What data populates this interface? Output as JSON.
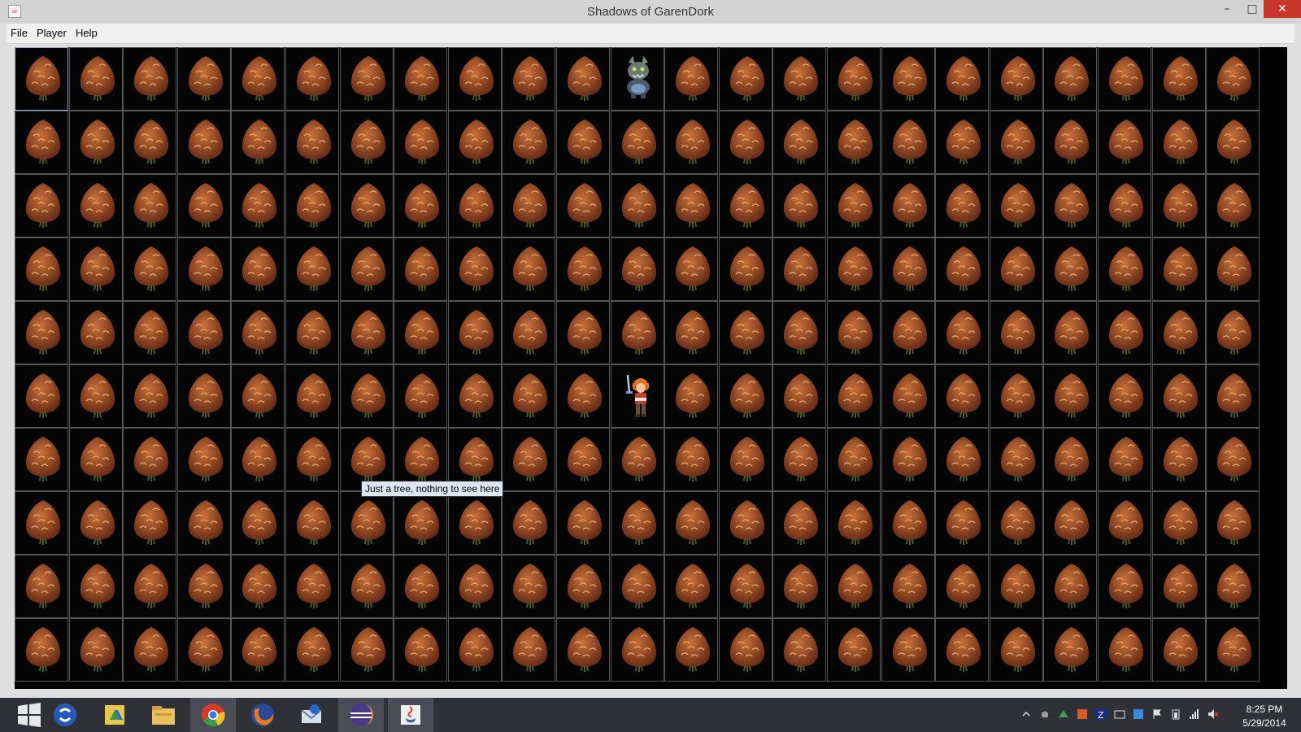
{
  "window": {
    "title": "Shadows of GarenDork",
    "app_icon": "java-icon",
    "controls": {
      "minimize": "–",
      "maximize": "□",
      "close": "✕"
    }
  },
  "menubar": {
    "items": [
      "File",
      "Player",
      "Help"
    ]
  },
  "map": {
    "columns": 23,
    "rows": 10,
    "default_tile": "tree",
    "entities": [
      {
        "name": "enemy-sprite",
        "type": "monster",
        "col": 12,
        "row": 1
      },
      {
        "name": "player-sprite",
        "type": "hero",
        "col": 12,
        "row": 6
      }
    ],
    "focused_tile": {
      "col": 1,
      "row": 1
    }
  },
  "tooltip": {
    "text": "Just a tree, nothing to see here"
  },
  "colors": {
    "tree_light": "#c8703a",
    "tree_dark": "#6b2e17",
    "tile_border": "#555555",
    "tooltip_bg": "#dbe6f4",
    "taskbar_bg": "#2f3137",
    "close_button": "#c8352b"
  },
  "taskbar": {
    "apps": [
      {
        "name": "start-icon",
        "active": false
      },
      {
        "name": "sync-app-icon",
        "active": false
      },
      {
        "name": "google-drive-icon",
        "active": false
      },
      {
        "name": "file-explorer-icon",
        "active": false
      },
      {
        "name": "chrome-icon",
        "active": true
      },
      {
        "name": "firefox-icon",
        "active": false
      },
      {
        "name": "thunderbird-icon",
        "active": false
      },
      {
        "name": "eclipse-icon",
        "active": true
      },
      {
        "name": "java-icon",
        "active": true
      }
    ],
    "tray_icons": [
      "show-hidden-icon",
      "notification-icon",
      "drive-tray-icon",
      "office-tray-icon",
      "filezilla-icon",
      "keyboard-icon",
      "network-tray-icon",
      "flag-icon",
      "battery-icon",
      "signal-icon",
      "volume-muted-icon"
    ],
    "time": "8:25 PM",
    "date": "5/29/2014"
  }
}
